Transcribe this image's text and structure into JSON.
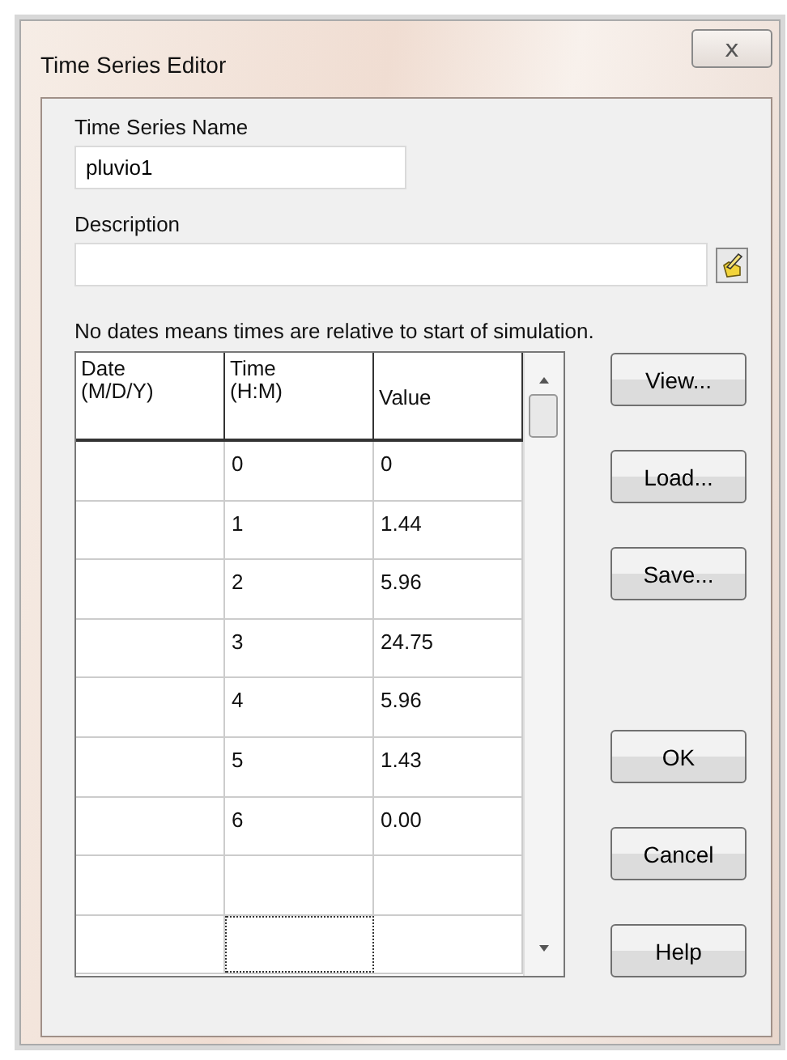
{
  "window": {
    "title": "Time Series Editor",
    "close_label": "ⅹ"
  },
  "name_field": {
    "label": "Time Series Name",
    "value": "pluvio1"
  },
  "description_field": {
    "label": "Description"
  },
  "note": "No dates means times are relative to start of simulation.",
  "table": {
    "columns": [
      "Date\n(M/D/Y)",
      "Time\n(H:M)",
      "Value"
    ],
    "rows": [
      {
        "time": "0",
        "value": "0",
        "time_focused": false
      },
      {
        "time": "1",
        "value": "1.44",
        "time_focused": false
      },
      {
        "time": "2",
        "value": "5.96",
        "time_focused": false
      },
      {
        "time": "3",
        "value": "24.75",
        "time_focused": false
      },
      {
        "time": "4",
        "value": "5.96",
        "time_focused": false
      },
      {
        "time": "5",
        "value": "1.43",
        "time_focused": false
      },
      {
        "time": "6",
        "value": "0.00",
        "time_focused": false
      },
      {
        "time_focused": false
      },
      {
        "time_focused": true
      }
    ]
  },
  "file_buttons": [
    "View...",
    "Load...",
    "Save..."
  ],
  "dialog_buttons": [
    "OK",
    "Cancel",
    "Help"
  ]
}
